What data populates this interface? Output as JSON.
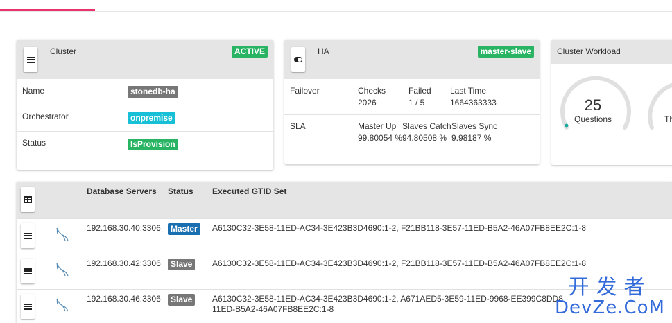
{
  "cluster": {
    "title": "Cluster",
    "state_badge": "ACTIVE",
    "rows": [
      {
        "label": "Name",
        "value": "stonedb-ha"
      },
      {
        "label": "Orchestrator",
        "value": "onpremise"
      },
      {
        "label": "Status",
        "value": "IsProvision"
      }
    ]
  },
  "ha": {
    "title": "HA",
    "mode_badge": "master-slave",
    "failover": {
      "label": "Failover",
      "checks_label": "Checks",
      "checks": "2026",
      "failed_label": "Failed",
      "failed": "1 / 5",
      "last_time_label": "Last Time",
      "last_time": "1664363333"
    },
    "sla": {
      "label": "SLA",
      "master_up_label": "Master Up",
      "master_up": "99.80054 %",
      "slaves_catch_label": "Slaves Catch",
      "slaves_catch": "94.80508 %",
      "slaves_sync_label": "Slaves Sync",
      "slaves_sync": "9.98187 %"
    }
  },
  "workload": {
    "title": "Cluster Workload",
    "gauges": [
      {
        "value": "25",
        "label": "Questions"
      },
      {
        "value": "",
        "label": "Th"
      }
    ]
  },
  "servers": {
    "columns": {
      "db_servers": "Database Servers",
      "status": "Status",
      "gtid": "Executed GTID Set"
    },
    "rows": [
      {
        "host": "192.168.30.40:3306",
        "status": "Master",
        "gtid_line1": "A6130C32-3E58-11ED-AC34-3E423B3D4690:1-2, F21BB118-3E57-11ED-B5A2-46A07FB8EE2C:1-8",
        "gtid_line2": ""
      },
      {
        "host": "192.168.30.42:3306",
        "status": "Slave",
        "gtid_line1": "A6130C32-3E58-11ED-AC34-3E423B3D4690:1-2, F21BB118-3E57-11ED-B5A2-46A07FB8EE2C:1-8",
        "gtid_line2": ""
      },
      {
        "host": "192.168.30.46:3306",
        "status": "Slave",
        "gtid_line1": "A6130C32-3E58-11ED-AC34-3E423B3D4690:1-2, A671AED5-3E59-11ED-9968-EE399C8DD8",
        "gtid_line2": "11ED-B5A2-46A07FB8EE2C:1-8"
      }
    ]
  },
  "watermark": {
    "line1": "开发者",
    "line2": "DevZe.CoM"
  },
  "colors": {
    "accent": "#e8336c",
    "green": "#28b463",
    "cyan": "#17c0d6",
    "blue": "#1a6fb0",
    "grey": "#777777"
  },
  "icons": {
    "menu": "hamburger-icon",
    "ha": "toggle-icon",
    "table": "table-icon",
    "db": "mysql-dolphin-icon"
  }
}
